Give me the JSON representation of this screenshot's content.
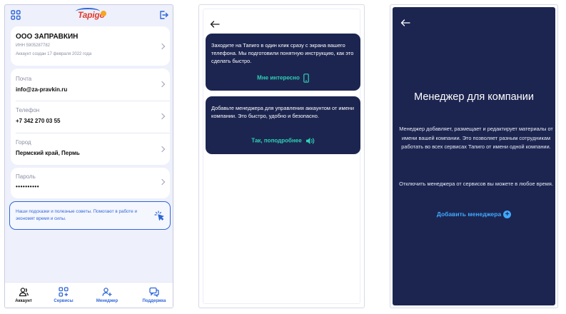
{
  "phone1": {
    "company": {
      "name": "ООО ЗАПРАВКИН",
      "inn": "ИНН 5905287782",
      "created": "Аккаунт создан 17 февраля 2022 года"
    },
    "fields": [
      {
        "label": "Почта",
        "value": "info@za-pravkin.ru"
      },
      {
        "label": "Телефон",
        "value": "+7 342 270 03 55"
      },
      {
        "label": "Город",
        "value": "Пермский край, Пермь"
      },
      {
        "label": "Пароль",
        "value": "••••••••••"
      }
    ],
    "hint": "Наши подсказки и полезные советы. Помогают в работе и экономят время и силы.",
    "tabs": [
      {
        "label": "Аккаунт",
        "icon": "user-icon",
        "active": true
      },
      {
        "label": "Сервисы",
        "icon": "services-icon",
        "active": false
      },
      {
        "label": "Менеджер",
        "icon": "add-user-icon",
        "active": false
      },
      {
        "label": "Поддержка",
        "icon": "chat-icon",
        "active": false
      }
    ],
    "logo": "Tapigo"
  },
  "phone2": {
    "cards": [
      {
        "text": "Заходите на Тапиго в один клик сразу с экрана вашего телефона. Мы подготовили понятную инструкцию, как это сделать быстро.",
        "link": "Мне интересно",
        "icon": "phone-icon"
      },
      {
        "text": "Добавьте менеджера для управления аккаунтом от имени компании. Это быстро, удобно и безопасно.",
        "link": "Так, поподробнее",
        "icon": "speaker-icon"
      }
    ]
  },
  "phone3": {
    "title": "Менеджер для компании",
    "para1": "Менеджер добавляет, размещает и редактирует материалы от имени вашей компании. Это позволяет разным сотрудникам работать во всех сервисах Тапиго от имени одной компании.",
    "para2": "Отключить менеджера от сервисов вы можете в любое время.",
    "link": "Добавить менеджера"
  },
  "colors": {
    "accent": "#2f66d8",
    "navy": "#1c2550",
    "teal": "#2fd1b6",
    "sky": "#3fa9ff",
    "background": "#eef0fb"
  }
}
